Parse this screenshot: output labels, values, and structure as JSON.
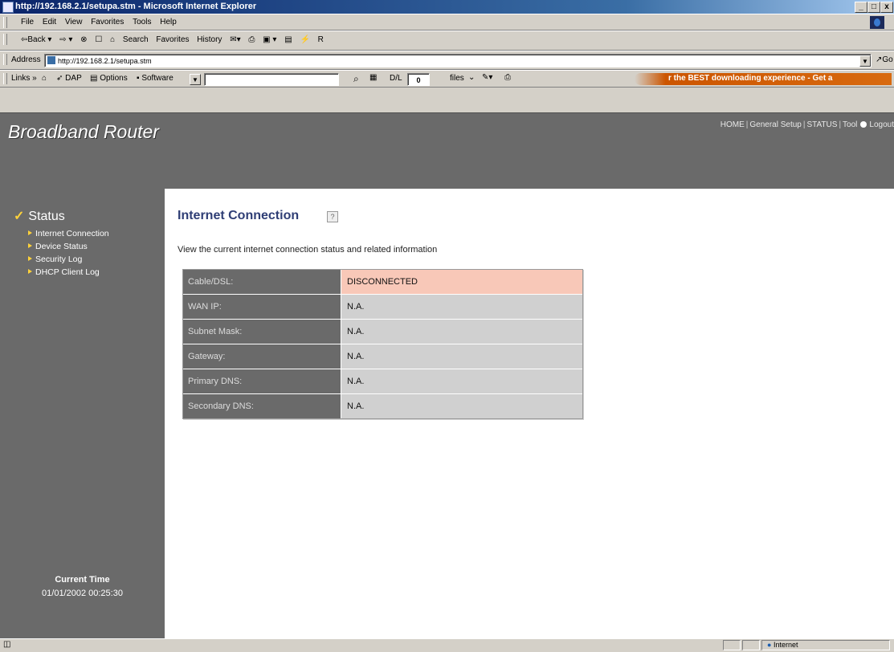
{
  "window": {
    "title": "http://192.168.2.1/setupa.stm - Microsoft Internet Explorer",
    "controls": [
      "_",
      "□",
      "x"
    ]
  },
  "menu": [
    "File",
    "Edit",
    "View",
    "Favorites",
    "Tools",
    "Help"
  ],
  "toolbar": [
    "⇦Back ▾",
    "⇨ ▾",
    "⊗",
    "☐",
    "⌂",
    "Search",
    "Favorites",
    "History",
    "✉▾",
    "⎙",
    "▣ ▾",
    "▤",
    "⚡",
    "R"
  ],
  "address": {
    "label": "Address",
    "url": "http://192.168.2.1/setupa.stm",
    "go_label": "Go"
  },
  "links": {
    "label": "Links »",
    "dap_label": "DAP",
    "options_label": "Options",
    "software_label": "Software",
    "dl_label": "D/L",
    "dl_count": "0",
    "files_label": "files",
    "banner": "r the BEST downloading experience - Get a"
  },
  "header": {
    "brand": "Broadband Router",
    "nav": [
      "HOME",
      "General Setup",
      "STATUS",
      "Tool"
    ],
    "logout": "Logout"
  },
  "sidebar": {
    "section": "Status",
    "items": [
      "Internet Connection",
      "Device Status",
      "Security Log",
      "DHCP Client Log"
    ],
    "time_label": "Current Time",
    "time_value": "01/01/2002 00:25:30"
  },
  "content": {
    "title": "Internet Connection",
    "description": "View the current internet connection status and related information",
    "rows": [
      {
        "label": "Cable/DSL:",
        "value": "DISCONNECTED"
      },
      {
        "label": "WAN IP:",
        "value": "N.A."
      },
      {
        "label": "Subnet Mask:",
        "value": "N.A."
      },
      {
        "label": "Gateway:",
        "value": "N.A."
      },
      {
        "label": "Primary DNS:",
        "value": "N.A."
      },
      {
        "label": "Secondary DNS:",
        "value": "N.A."
      }
    ]
  },
  "statusbar": {
    "zone": "Internet"
  },
  "colors": {
    "panel_gray": "#6a6a6a",
    "title_blue": "#2f3e75",
    "alert_cell": "#f8c8b8",
    "value_cell": "#d0d0d0",
    "accent_yellow": "#ffd23a"
  }
}
